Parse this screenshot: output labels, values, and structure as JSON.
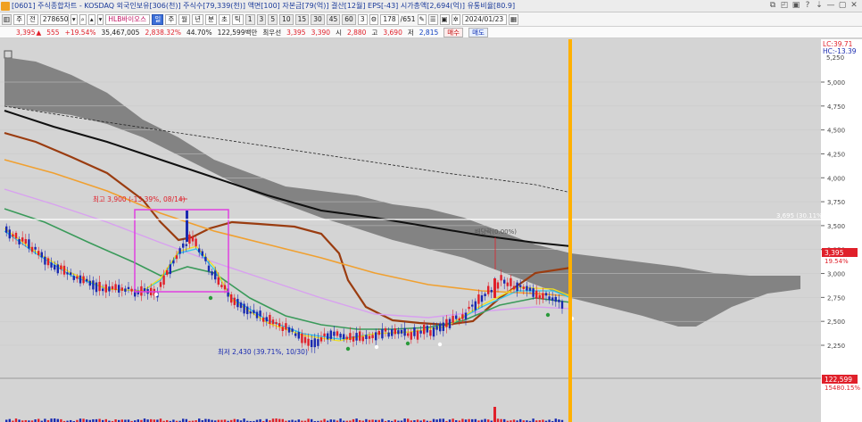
{
  "window": {
    "title": "[0601] 주식종합차트 - KOSDAQ 외국인보유[306(천)] 주식수[79,339(천)] 액면[100] 자본금[79(억)] 결산[12월] EPS[-43] 시가총액[2,694(억)] 유통비율[80.9]",
    "controls": [
      "⧉",
      "◰",
      "▣",
      "?",
      "⇣",
      "—",
      "▢",
      "✕"
    ]
  },
  "toolbar": {
    "mode_label": "주",
    "market_label": "전",
    "code": "278650",
    "stock_name": "HLB바이오스",
    "period_selected": "일",
    "periods": [
      "주",
      "월",
      "년",
      "분",
      "초",
      "틱"
    ],
    "interval_buttons": [
      "1",
      "3",
      "5",
      "10",
      "15",
      "30",
      "45",
      "60",
      "3"
    ],
    "count": "178",
    "count_total": "/651",
    "date": "2024/01/23"
  },
  "quote": {
    "price": "3,395",
    "change": "555",
    "change_pct": "+19.54%",
    "volume": "35,467,005",
    "volume_pct": "2,838.32%",
    "turnover": "44.70%",
    "amount": "122,599백만",
    "best_ask_label": "최우선",
    "best_ask": "3,395",
    "best_bid": "3,390",
    "open_label": "시",
    "open": "2,880",
    "high_label": "고",
    "high": "3,690",
    "low_label": "저",
    "low": "2,815",
    "buy_label": "매수",
    "sell_label": "매도"
  },
  "chart_labels": {
    "high_annotation": "최고 3,900 (-13.39%, 08/14)",
    "low_annotation": "최저 2,430 (39.71%, 10/30)",
    "event_annotation": "배당락(0.00%)",
    "hline_label": "3,695 (30.11%)",
    "lc_label": "LC:39.71",
    "hc_label": "HC:-13.39",
    "price_tag": "3,395",
    "pct_tag": "19.54%",
    "vol_tag": "122,599",
    "vol_pct_tag": "15480.15%",
    "axis_top": "5,250"
  },
  "chart_data": {
    "type": "candlestick",
    "ylim": [
      2100,
      5300
    ],
    "price_axis_ticks": [
      "5,000",
      "4,750",
      "4,500",
      "4,250",
      "4,000",
      "3,750",
      "3,500",
      "3,250",
      "3,000",
      "2,750",
      "2,500",
      "2,250"
    ],
    "price_axis_values": [
      5000,
      4750,
      4500,
      4250,
      4000,
      3750,
      3500,
      3250,
      3000,
      2750,
      2500,
      2250
    ],
    "horizontal_line": 3695,
    "highest": 3900,
    "lowest": 2430,
    "last_close": 3395,
    "colors": {
      "up": "#e0202a",
      "down": "#1a2ab0",
      "cloud": "#7a7a7a",
      "ma_long": "#101010",
      "ma_brown": "#9a3c10",
      "ma_orange": "#f0a030",
      "ma_violet": "#d8a0f0",
      "ma_green": "#3a9a5a",
      "ma_cyan": "#30c8e8",
      "ma_yellow": "#f0e020",
      "box": "#e040e0",
      "cursor": "#ffb000"
    }
  }
}
